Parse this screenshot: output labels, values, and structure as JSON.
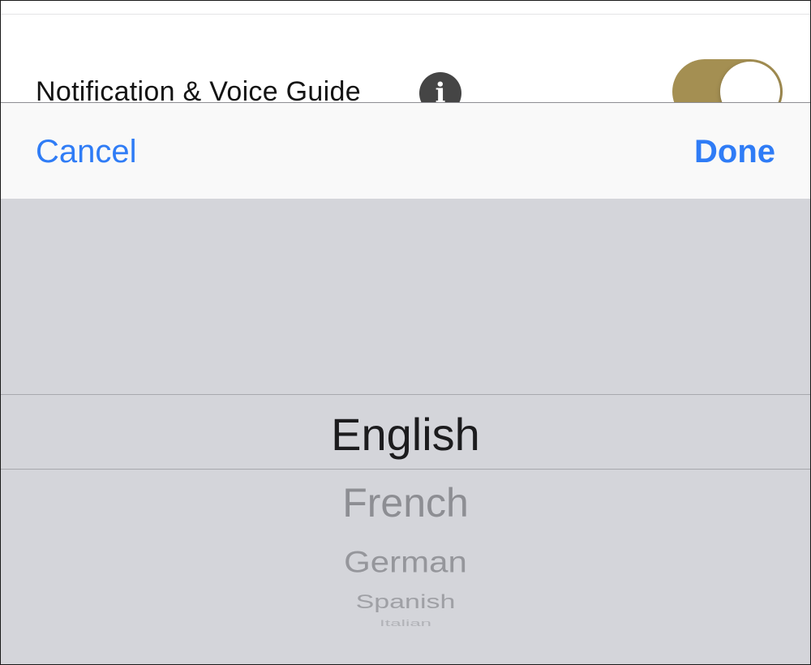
{
  "settings": {
    "row_label": "Notification & Voice Guide",
    "info_icon": "info-icon",
    "toggle_on": true,
    "toggle_color": "#a48f52"
  },
  "toolbar": {
    "cancel_label": "Cancel",
    "done_label": "Done",
    "accent_color": "#2f7cf6"
  },
  "picker": {
    "selected": "English",
    "options": [
      "French",
      "German",
      "Spanish",
      "Italian"
    ]
  }
}
